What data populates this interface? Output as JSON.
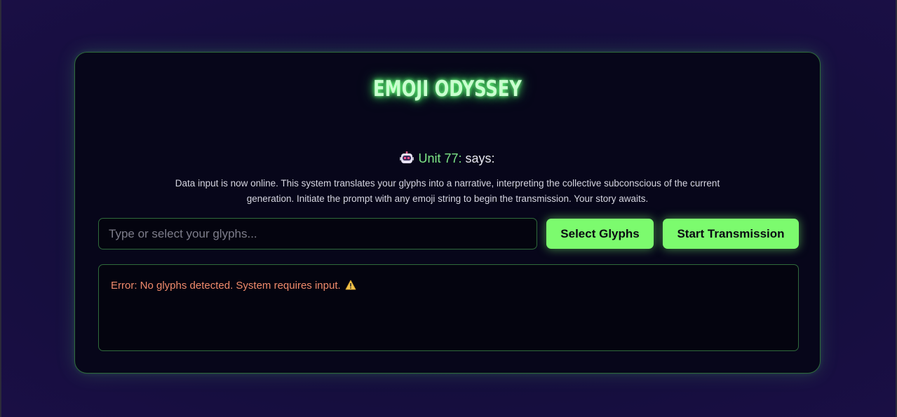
{
  "app": {
    "title": "EMOJI ODYSSEY"
  },
  "speaker": {
    "icon": "robot-icon",
    "name": "Unit 77:",
    "verb": "says:"
  },
  "description": "Data input is now online. This system translates your glyphs into a narrative, interpreting the collective subconscious of the current generation. Initiate the prompt with any emoji string to begin the transmission. Your story awaits.",
  "input": {
    "value": "",
    "placeholder": "Type or select your glyphs..."
  },
  "buttons": {
    "select_label": "Select Glyphs",
    "start_label": "Start Transmission"
  },
  "output": {
    "error_text": "Error: No glyphs detected. System requires input.",
    "error_icon": "warning-icon"
  },
  "colors": {
    "accent": "#7cfb6e",
    "speaker_name": "#7ee787",
    "error": "#f08a6b",
    "panel_border": "#2f6a3b"
  }
}
